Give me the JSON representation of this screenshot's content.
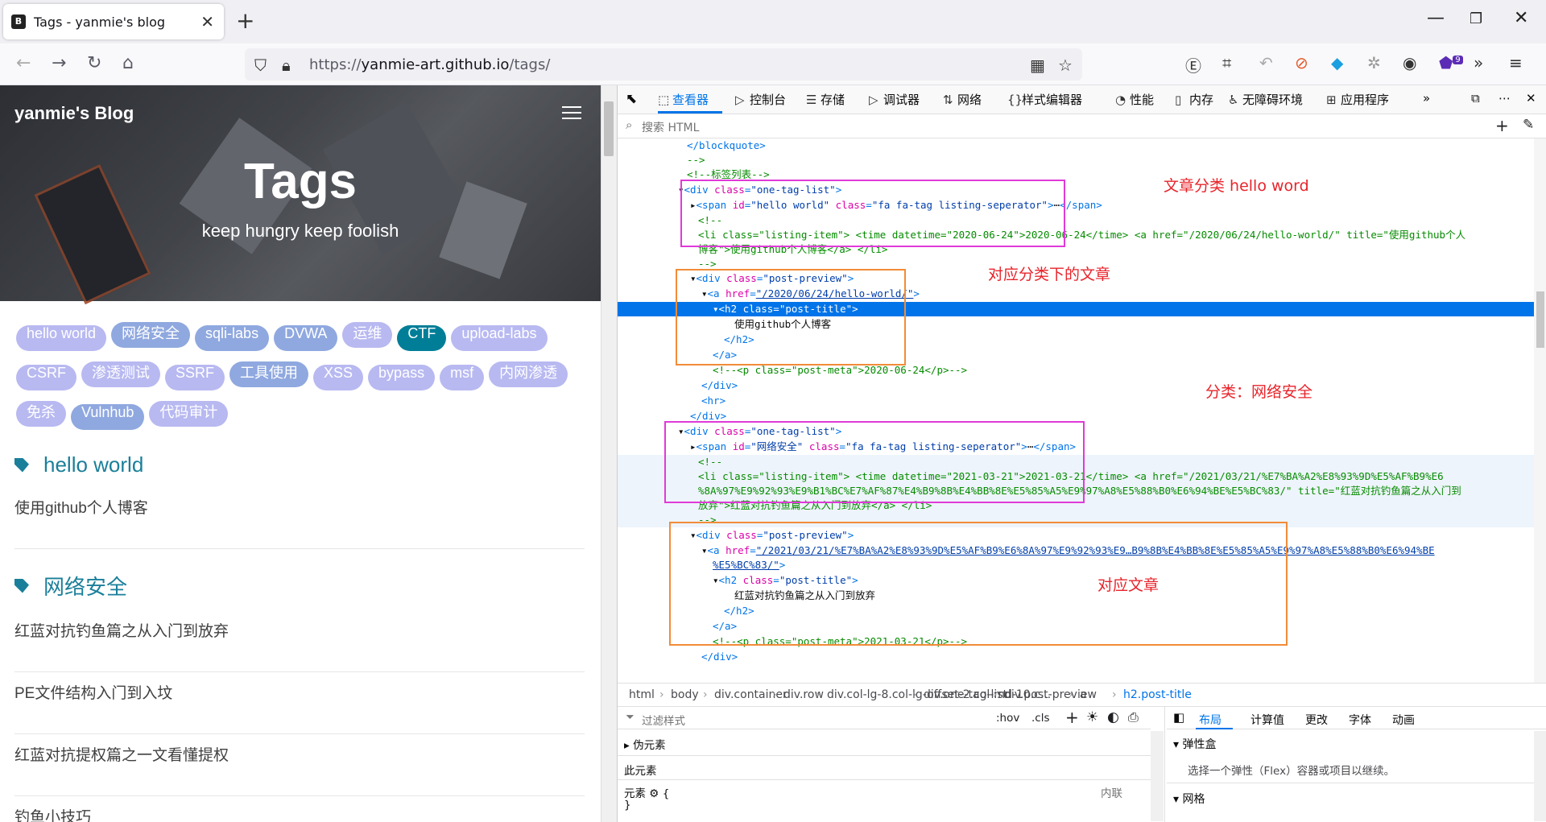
{
  "browser": {
    "tab_title": "Tags - yanmie's blog",
    "favicon_text": "B",
    "url_scheme": "https://",
    "url_host": "yanmie-art.github.io",
    "url_path": "/tags/",
    "extension_badge": "9"
  },
  "page": {
    "brand": "yanmie's Blog",
    "title": "Tags",
    "subtitle": "keep hungry keep foolish",
    "tags": [
      {
        "label": "hello world",
        "style": "t1"
      },
      {
        "label": "网络安全",
        "style": "t2"
      },
      {
        "label": "sqli-labs",
        "style": "t2"
      },
      {
        "label": "DVWA",
        "style": "t2"
      },
      {
        "label": "运维",
        "style": "t1"
      },
      {
        "label": "CTF",
        "style": "t3"
      },
      {
        "label": "upload-labs",
        "style": "t1"
      },
      {
        "label": "CSRF",
        "style": "t1"
      },
      {
        "label": "渗透测试",
        "style": "t1"
      },
      {
        "label": "SSRF",
        "style": "t1"
      },
      {
        "label": "工具使用",
        "style": "t2"
      },
      {
        "label": "XSS",
        "style": "t1"
      },
      {
        "label": "bypass",
        "style": "t1"
      },
      {
        "label": "msf",
        "style": "t1"
      },
      {
        "label": "内网渗透",
        "style": "t1"
      },
      {
        "label": "免杀",
        "style": "t1"
      },
      {
        "label": "Vulnhub",
        "style": "t2"
      },
      {
        "label": "代码审计",
        "style": "t1"
      }
    ],
    "sections": [
      {
        "heading": "hello world",
        "posts": [
          "使用github个人博客"
        ]
      },
      {
        "heading": "网络安全",
        "posts": [
          "红蓝对抗钓鱼篇之从入门到放弃",
          "PE文件结构入门到入坟",
          "红蓝对抗提权篇之一文看懂提权",
          "钓鱼小技巧"
        ]
      }
    ]
  },
  "devtools": {
    "tabs": [
      {
        "icon": "⬚",
        "label": "查看器",
        "selected": true
      },
      {
        "icon": "▷",
        "label": "控制台"
      },
      {
        "icon": "☰",
        "label": "存储"
      },
      {
        "icon": "▷",
        "label": "调试器"
      },
      {
        "icon": "⇅",
        "label": "网络"
      },
      {
        "icon": "{}",
        "label": "样式编辑器"
      },
      {
        "icon": "◔",
        "label": "性能"
      },
      {
        "icon": "▯",
        "label": "内存"
      },
      {
        "icon": "♿",
        "label": "无障碍环境"
      },
      {
        "icon": "⊞",
        "label": "应用程序"
      }
    ],
    "search_placeholder": "搜索 HTML",
    "annotations": [
      "文章分类 hello word",
      "对应分类下的文章",
      "分类：网络安全",
      "对应文章"
    ],
    "breadcrumbs": [
      "html",
      "body",
      "div.container",
      "div.row",
      "div.col-lg-8.col-lg-offset-2.col-md-10.c...",
      "div.one-tag-list",
      "div.post-preview",
      "a",
      "h2.post-title"
    ],
    "rules": {
      "filter_placeholder": "过滤样式",
      "hov": ":hov",
      "cls": ".cls",
      "pseudo": "伪元素",
      "this_element": "此元素",
      "element_label": "元素",
      "brace_open": "{",
      "brace_close": "}",
      "inline": "内联"
    },
    "layout": {
      "tabs": [
        "布局",
        "计算值",
        "更改",
        "字体",
        "动画"
      ],
      "flexbox": "弹性盒",
      "flex_hint": "选择一个弹性（Flex）容器或项目以继续。",
      "grid": "网格"
    }
  }
}
